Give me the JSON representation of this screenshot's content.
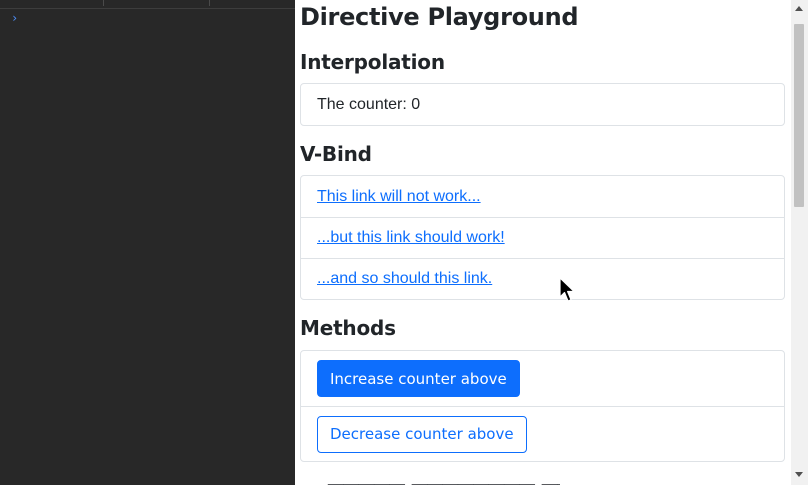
{
  "console": {
    "prompt_glyph": "›"
  },
  "page": {
    "title": "Directive Playground",
    "interpolation": {
      "heading": "Interpolation",
      "counter_label": "The counter: 0"
    },
    "vbind": {
      "heading": "V-Bind",
      "links": [
        "This link will not work...",
        "...but this link should work!",
        "...and so should this link."
      ]
    },
    "methods": {
      "heading": "Methods",
      "increase_label": "Increase counter above",
      "decrease_label": "Decrease counter above"
    }
  },
  "colors": {
    "console_bg": "#282828",
    "link": "#0d6efd",
    "primary": "#0d6efd",
    "border": "#dee2e6"
  },
  "icons": {
    "console_prompt": "chevron-right-icon",
    "cursor": "mouse-pointer-icon"
  }
}
